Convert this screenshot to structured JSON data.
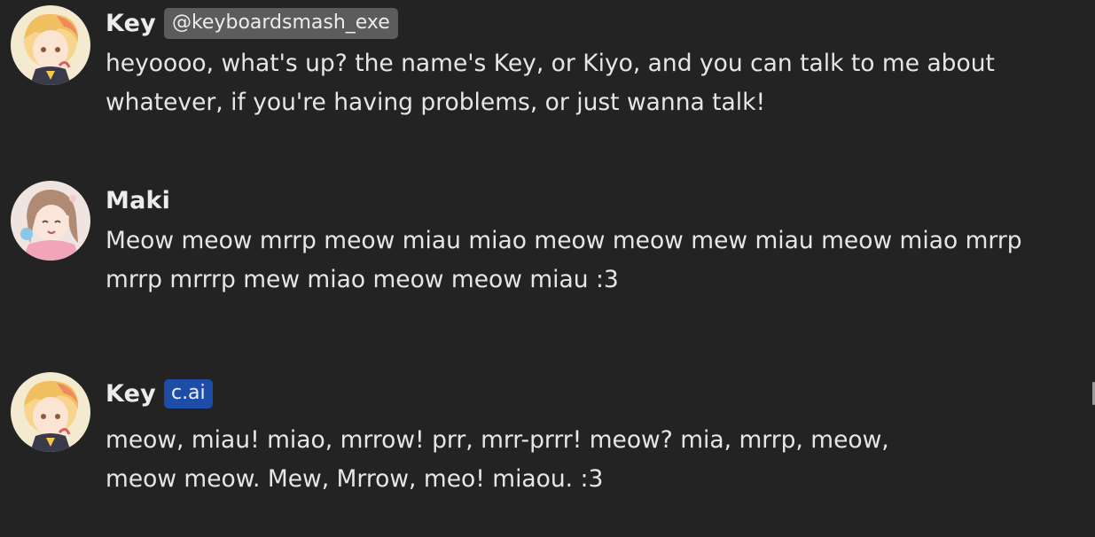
{
  "messages": [
    {
      "author": "Key",
      "handle": "@keyboardsmash_exe",
      "text": "heyoooo, what's up? the name's Key, or Kiyo, and you can talk to me about\nwhatever, if you're having problems, or just wanna talk!",
      "avatar_icon": "blond-anime-boy-avatar"
    },
    {
      "author": "Maki",
      "text": "Meow meow mrrp meow miau miao meow meow mew miau meow miao mrrp\nmrrp mrrrp mew miao meow meow miau :3",
      "avatar_icon": "brown-haired-anime-girl-avatar"
    },
    {
      "author": "Key",
      "badge": "c.ai",
      "badge_color": "#1e4da8",
      "text": "meow, miau! miao, mrrow! prr, mrr-prrr! meow? mia, mrrp, meow,\nmeow meow. Mew, Mrrow, meo! miaou. :3",
      "avatar_icon": "blond-anime-boy-avatar"
    }
  ],
  "colors": {
    "background": "#232323",
    "handle_tag": "#5c5c5c",
    "ai_badge": "#1e4da8"
  }
}
